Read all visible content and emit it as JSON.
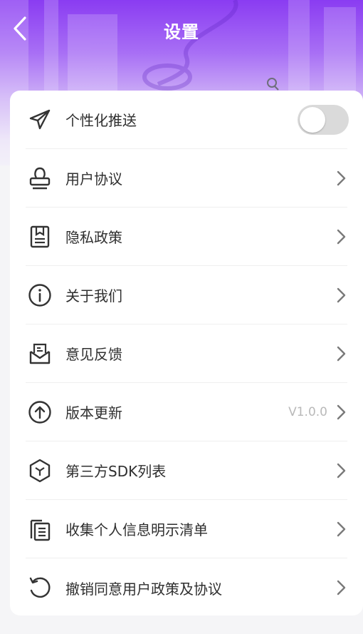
{
  "header": {
    "title": "设置",
    "back_icon": "back-arrow-icon"
  },
  "settings": {
    "items": [
      {
        "label": "个性化推送",
        "icon": "paper-plane-icon",
        "control": "toggle",
        "toggle_on": false
      },
      {
        "label": "用户协议",
        "icon": "stamp-icon",
        "control": "chevron"
      },
      {
        "label": "隐私政策",
        "icon": "bookmark-book-icon",
        "control": "chevron"
      },
      {
        "label": "关于我们",
        "icon": "info-icon",
        "control": "chevron"
      },
      {
        "label": "意见反馈",
        "icon": "feedback-envelope-icon",
        "control": "chevron"
      },
      {
        "label": "版本更新",
        "icon": "upload-circle-icon",
        "control": "chevron",
        "value": "V1.0.0"
      },
      {
        "label": "第三方SDK列表",
        "icon": "cube-icon",
        "control": "chevron"
      },
      {
        "label": "收集个人信息明示清单",
        "icon": "documents-icon",
        "control": "chevron"
      },
      {
        "label": "撤销同意用户政策及协议",
        "icon": "revoke-refresh-icon",
        "control": "chevron"
      }
    ]
  },
  "colors": {
    "header_gradient_top": "#8a3cf2",
    "toggle_off": "#dadada",
    "value_text": "#b9b9b9"
  }
}
